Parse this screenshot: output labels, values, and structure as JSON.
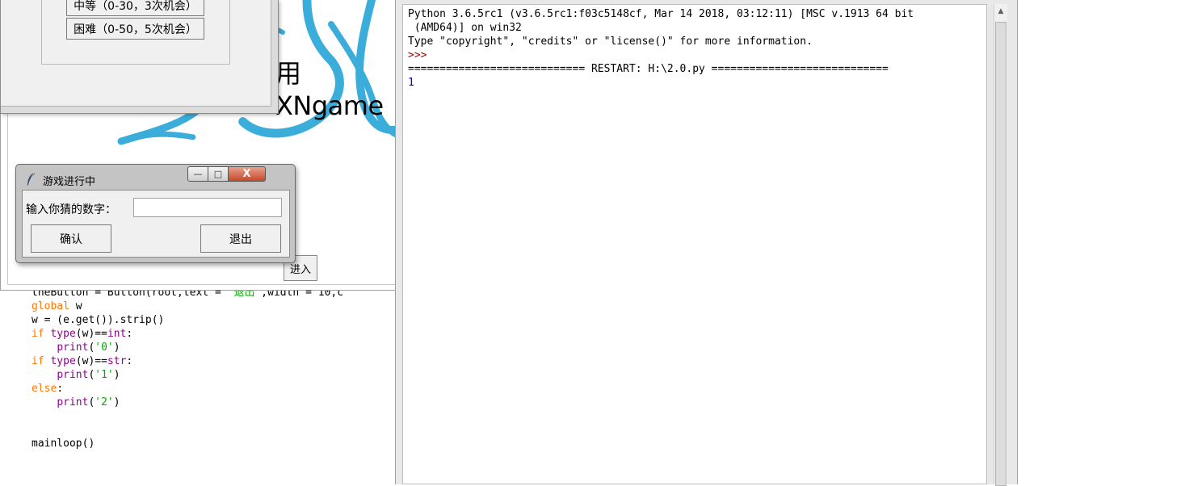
{
  "editor": {
    "lines": [
      {
        "parts": [
          {
            "t": "theButton = Button(root,text = ",
            "c": ""
          },
          {
            "t": "'退出'",
            "c": "st"
          },
          {
            "t": ",width = 10,c",
            "c": ""
          }
        ]
      },
      {
        "parts": [
          {
            "t": "global",
            "c": "kw"
          },
          {
            "t": " w",
            "c": ""
          }
        ]
      },
      {
        "parts": [
          {
            "t": "w = (e.get()).strip()",
            "c": ""
          }
        ]
      },
      {
        "parts": [
          {
            "t": "if",
            "c": "kw"
          },
          {
            "t": " ",
            "c": ""
          },
          {
            "t": "type",
            "c": "bi"
          },
          {
            "t": "(w)==",
            "c": ""
          },
          {
            "t": "int",
            "c": "bi"
          },
          {
            "t": ":",
            "c": ""
          }
        ]
      },
      {
        "parts": [
          {
            "t": "    ",
            "c": ""
          },
          {
            "t": "print",
            "c": "bi"
          },
          {
            "t": "(",
            "c": ""
          },
          {
            "t": "'0'",
            "c": "st"
          },
          {
            "t": ")",
            "c": ""
          }
        ]
      },
      {
        "parts": [
          {
            "t": "if",
            "c": "kw"
          },
          {
            "t": " ",
            "c": ""
          },
          {
            "t": "type",
            "c": "bi"
          },
          {
            "t": "(w)==",
            "c": ""
          },
          {
            "t": "str",
            "c": "bi"
          },
          {
            "t": ":",
            "c": ""
          }
        ]
      },
      {
        "parts": [
          {
            "t": "    ",
            "c": ""
          },
          {
            "t": "print",
            "c": "bi"
          },
          {
            "t": "(",
            "c": ""
          },
          {
            "t": "'1'",
            "c": "st"
          },
          {
            "t": ")",
            "c": ""
          }
        ]
      },
      {
        "parts": [
          {
            "t": "else",
            "c": "kw"
          },
          {
            "t": ":",
            "c": ""
          }
        ]
      },
      {
        "parts": [
          {
            "t": "    ",
            "c": ""
          },
          {
            "t": "print",
            "c": "bi"
          },
          {
            "t": "(",
            "c": ""
          },
          {
            "t": "'2'",
            "c": "st"
          },
          {
            "t": ")",
            "c": ""
          }
        ]
      },
      {
        "parts": []
      },
      {
        "parts": []
      },
      {
        "parts": [
          {
            "t": "mainloop()",
            "c": ""
          }
        ]
      }
    ]
  },
  "main_window": {
    "title_text": "XNgame",
    "title_prefix": "用",
    "enter_button": "进入"
  },
  "difficulty_window": {
    "medium_label": "中等（0-30，3次机会）",
    "hard_label": "困难（0-50，5次机会）"
  },
  "game_dialog": {
    "title": "游戏进行中",
    "input_label": "输入你猜的数字：",
    "input_value": "",
    "confirm_label": "确认",
    "exit_label": "退出",
    "close_glyph": "X",
    "min_glyph": "—",
    "max_glyph": "□"
  },
  "shell": {
    "banner1": "Python 3.6.5rc1 (v3.6.5rc1:f03c5148cf, Mar 14 2018, 03:12:11) [MSC v.1913 64 bit",
    "banner2": " (AMD64)] on win32",
    "banner3": "Type \"copyright\", \"credits\" or \"license()\" for more information.",
    "prompt": ">>> ",
    "restart": "============================ RESTART: H:\\2.0.py ============================",
    "output": "1"
  },
  "colors": {
    "keyword": "#ff7700",
    "builtin": "#900090",
    "string": "#00aa00",
    "swirl": "#1a9fd4",
    "close_button": "#c8482a",
    "shell_output": "#0000cc",
    "shell_prompt": "#990000"
  }
}
